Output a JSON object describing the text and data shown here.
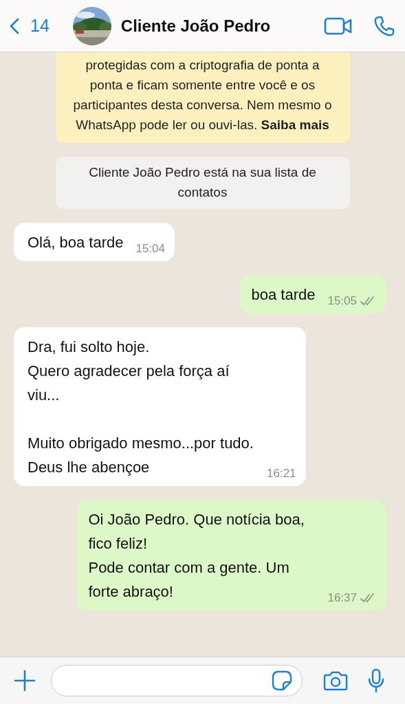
{
  "header": {
    "back_count": "14",
    "title": "Cliente João Pedro"
  },
  "notices": [
    {
      "kind": "encryption",
      "text": "protegidas com a criptografia de ponta a ponta e ficam somente entre você e os participantes desta conversa. Nem mesmo o WhatsApp pode ler ou ouvi-las. **Saiba mais**"
    },
    {
      "kind": "system",
      "text": "Cliente João Pedro está na sua lista de contatos"
    }
  ],
  "messages": [
    {
      "kind": "incoming",
      "text": "Olá, boa tarde",
      "time": "15:04"
    },
    {
      "kind": "outgoing",
      "text": "boa tarde",
      "time": "15:05",
      "read": false
    },
    {
      "kind": "incoming",
      "text": "Dra, fui solto hoje.\nQuero agradecer pela força aí viu...\n\nMuito obrigado mesmo...por tudo.\nDeus lhe abençoe",
      "time": "16:21"
    },
    {
      "kind": "outgoing",
      "text": "Oi João Pedro. Que notícia boa, fico feliz!\nPode contar com a gente. Um forte abraço!",
      "time": "16:37",
      "read": false
    }
  ]
}
